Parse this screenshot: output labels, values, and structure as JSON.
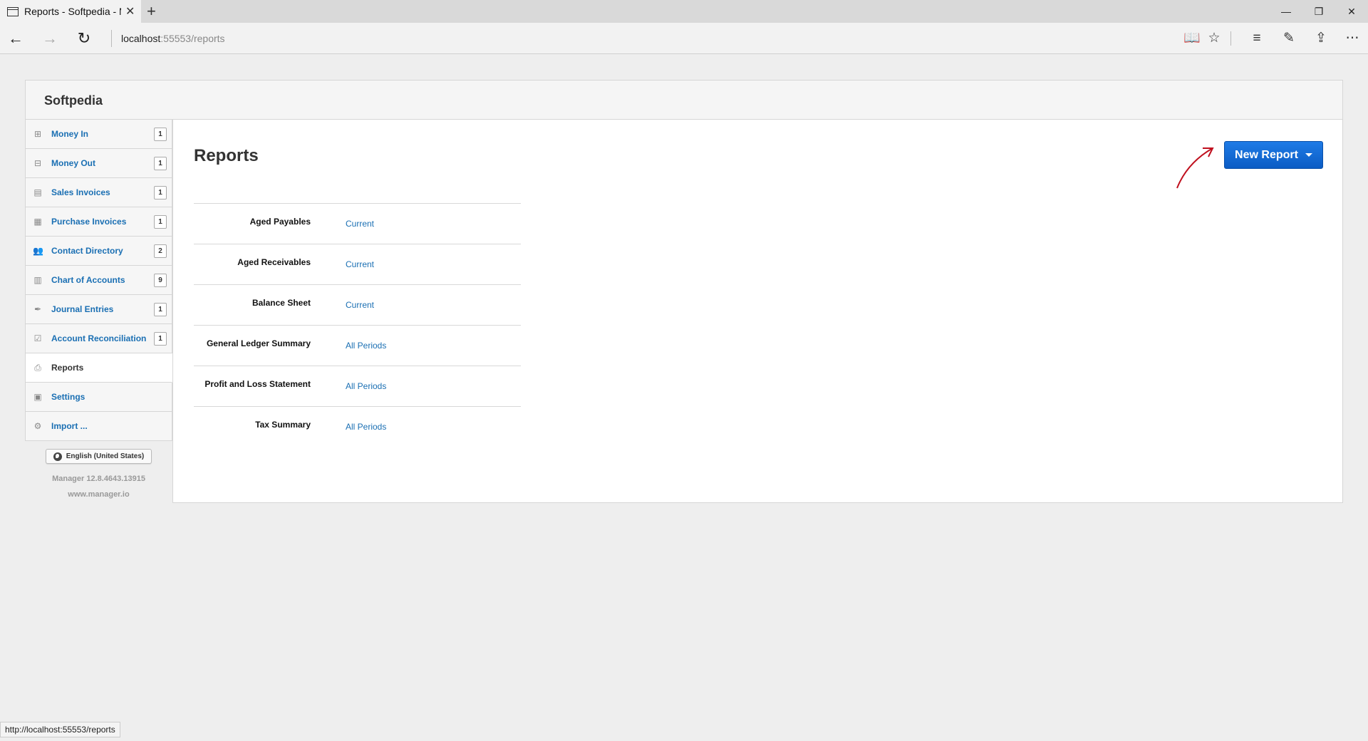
{
  "browser": {
    "tab_title": "Reports - Softpedia - M",
    "url_host": "localhost",
    "url_path": ":55553/reports",
    "status_url": "http://localhost:55553/reports",
    "icons": [
      "back-icon",
      "forward-icon",
      "refresh-icon",
      "reading-view-icon",
      "favorite-star-icon",
      "hub-icon",
      "web-note-icon",
      "share-icon",
      "more-icon"
    ]
  },
  "app": {
    "brand": "Softpedia",
    "page_title": "Reports",
    "new_report_label": "New Report",
    "accent_color": "#1a6fb3",
    "button_color": "#1565d8"
  },
  "sidebar": {
    "items": [
      {
        "label": "Money In",
        "badge": "1",
        "icon": "plus-square-icon"
      },
      {
        "label": "Money Out",
        "badge": "1",
        "icon": "minus-square-icon"
      },
      {
        "label": "Sales Invoices",
        "badge": "1",
        "icon": "cash-register-icon"
      },
      {
        "label": "Purchase Invoices",
        "badge": "1",
        "icon": "calendar-icon"
      },
      {
        "label": "Contact Directory",
        "badge": "2",
        "icon": "users-icon"
      },
      {
        "label": "Chart of Accounts",
        "badge": "9",
        "icon": "book-icon"
      },
      {
        "label": "Journal Entries",
        "badge": "1",
        "icon": "pen-icon"
      },
      {
        "label": "Account Reconciliation",
        "badge": "1",
        "icon": "checkbox-icon"
      },
      {
        "label": "Reports",
        "icon": "printer-icon"
      },
      {
        "label": "Settings",
        "icon": "settings-panel-icon"
      },
      {
        "label": "Import ...",
        "icon": "import-icon"
      }
    ],
    "language": "English (United States)",
    "version": "Manager 12.8.4643.13915",
    "site": "www.manager.io"
  },
  "reports": [
    {
      "name": "Aged Payables",
      "period": "Current"
    },
    {
      "name": "Aged Receivables",
      "period": "Current"
    },
    {
      "name": "Balance Sheet",
      "period": "Current"
    },
    {
      "name": "General Ledger Summary",
      "period": "All Periods"
    },
    {
      "name": "Profit and Loss Statement",
      "period": "All Periods"
    },
    {
      "name": "Tax Summary",
      "period": "All Periods"
    }
  ]
}
